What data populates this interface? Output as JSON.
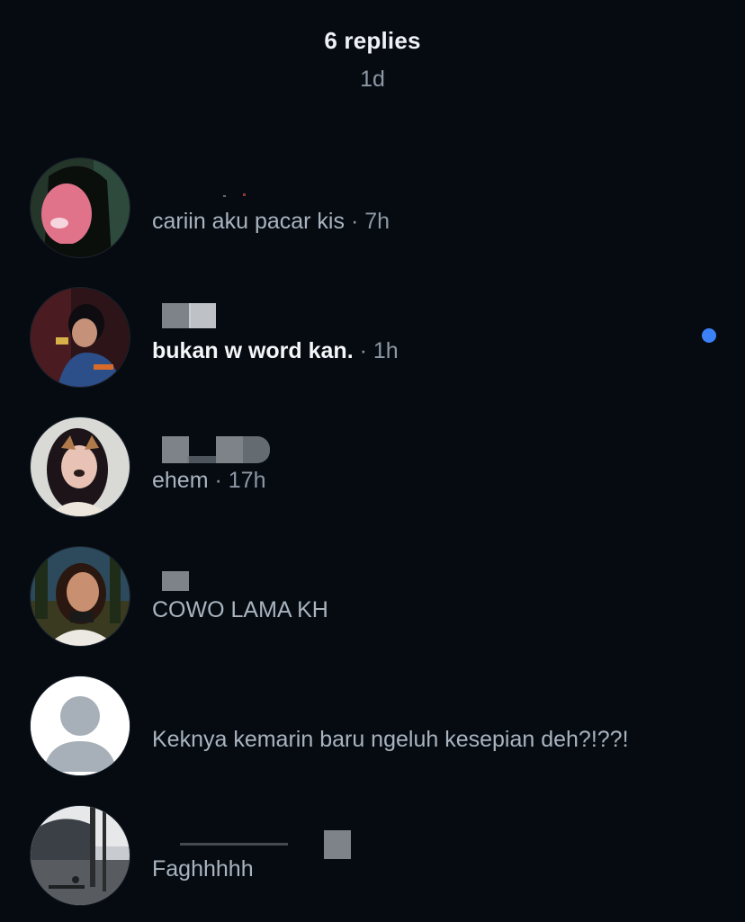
{
  "header": {
    "title": "6 replies",
    "time": "1d"
  },
  "separator": "·",
  "replies": [
    {
      "message": "cariin aku pacar kis",
      "time": "7h",
      "unread": false,
      "avatar": "photo-avatar"
    },
    {
      "message": "bukan w word kan.",
      "time": "1h",
      "unread": true,
      "avatar": "photo-avatar"
    },
    {
      "message": "ehem",
      "time": "17h",
      "unread": false,
      "avatar": "photo-avatar"
    },
    {
      "message": "COWO LAMA KH",
      "time": "",
      "unread": false,
      "avatar": "photo-avatar"
    },
    {
      "message": "Keknya kemarin baru ngeluh kesepian deh?!??!",
      "time": "",
      "unread": false,
      "avatar": "default-profile-icon"
    },
    {
      "message": "Faghhhhh",
      "time": "",
      "unread": false,
      "avatar": "photo-avatar"
    }
  ],
  "colors": {
    "background": "#060b12",
    "unread_dot": "#3c82f6",
    "primary_text": "#eef2f6",
    "secondary_text": "#a9b4bf"
  }
}
